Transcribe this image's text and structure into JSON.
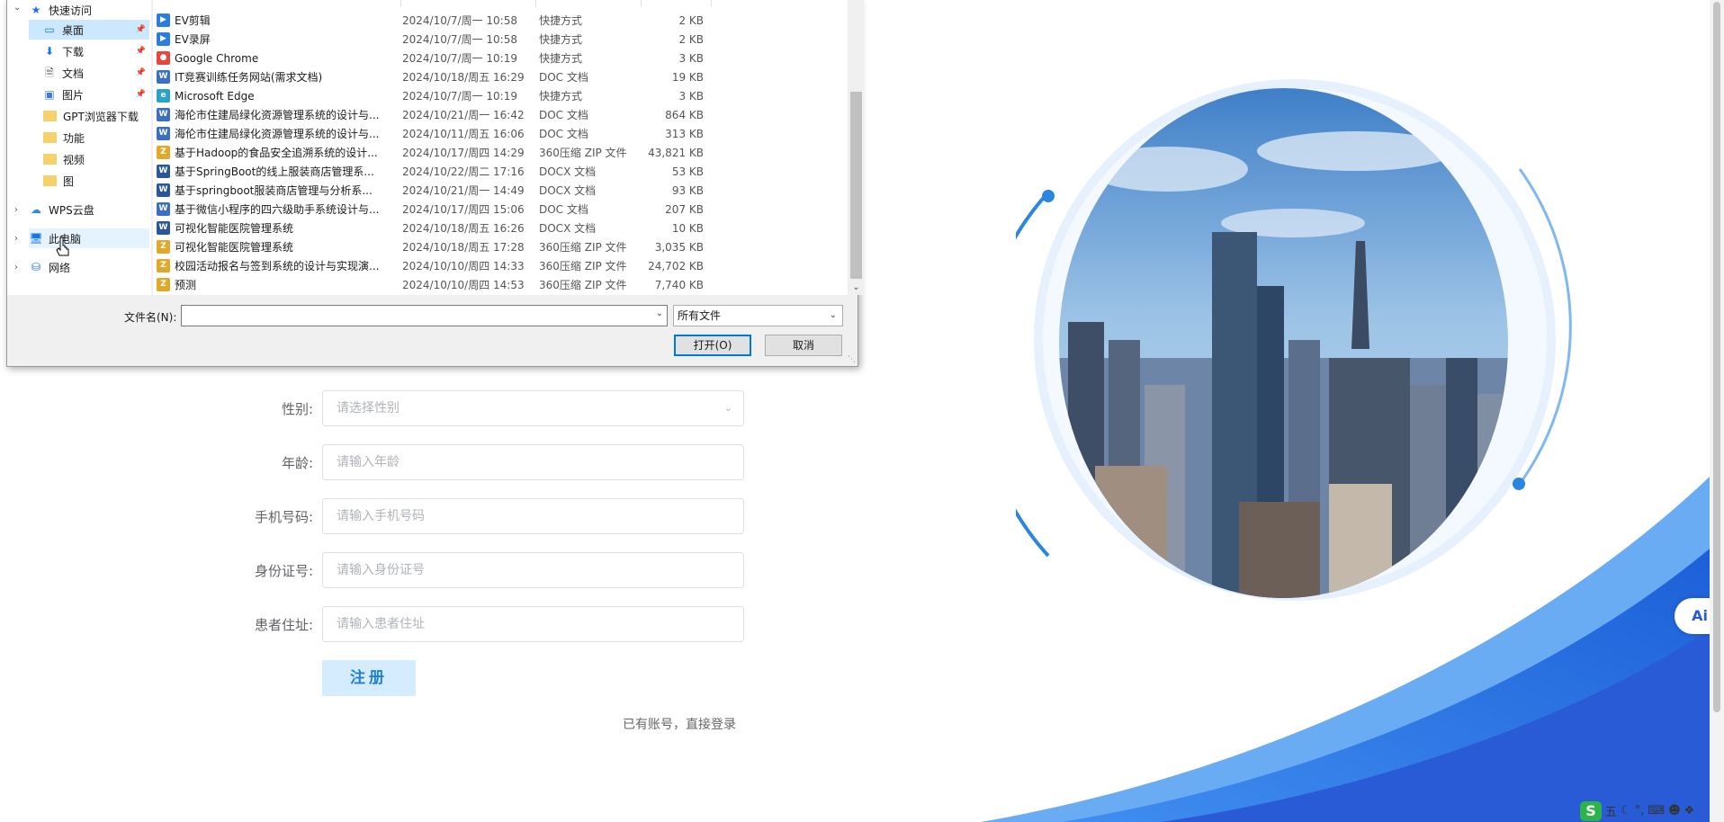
{
  "dialog": {
    "nav": {
      "quick_access": "快速访问",
      "items": [
        {
          "label": "桌面",
          "icon": "desktop-icon",
          "pinned": true
        },
        {
          "label": "下载",
          "icon": "download-icon",
          "pinned": true
        },
        {
          "label": "文档",
          "icon": "documents-icon",
          "pinned": true
        },
        {
          "label": "图片",
          "icon": "pictures-icon",
          "pinned": true
        },
        {
          "label": "GPT浏览器下载",
          "icon": "folder-icon",
          "pinned": false
        },
        {
          "label": "功能",
          "icon": "folder-icon",
          "pinned": false
        },
        {
          "label": "视频",
          "icon": "folder-icon",
          "pinned": false
        },
        {
          "label": "图",
          "icon": "folder-icon",
          "pinned": false
        }
      ],
      "wps_cloud": "WPS云盘",
      "this_pc": "此电脑",
      "network": "网络"
    },
    "files": [
      {
        "name": "EV剪辑",
        "date": "2024/10/7/周一 10:58",
        "type": "快捷方式",
        "size": "2 KB",
        "icon": "shortcut-ev-icon"
      },
      {
        "name": "EV录屏",
        "date": "2024/10/7/周一 10:58",
        "type": "快捷方式",
        "size": "2 KB",
        "icon": "shortcut-ev-icon"
      },
      {
        "name": "Google Chrome",
        "date": "2024/10/7/周一 10:19",
        "type": "快捷方式",
        "size": "3 KB",
        "icon": "chrome-icon"
      },
      {
        "name": "IT竞赛训练任务网站(需求文档)",
        "date": "2024/10/18/周五 16:29",
        "type": "DOC 文档",
        "size": "19 KB",
        "icon": "doc-icon"
      },
      {
        "name": "Microsoft Edge",
        "date": "2024/10/7/周一 10:19",
        "type": "快捷方式",
        "size": "3 KB",
        "icon": "edge-icon"
      },
      {
        "name": "海伦市住建局绿化资源管理系统的设计与...",
        "date": "2024/10/21/周一 16:42",
        "type": "DOC 文档",
        "size": "864 KB",
        "icon": "doc-icon"
      },
      {
        "name": "海伦市住建局绿化资源管理系统的设计与...",
        "date": "2024/10/11/周五 16:06",
        "type": "DOC 文档",
        "size": "313 KB",
        "icon": "doc-icon"
      },
      {
        "name": "基于Hadoop的食品安全追溯系统的设计...",
        "date": "2024/10/17/周四 14:29",
        "type": "360压缩 ZIP 文件",
        "size": "43,821 KB",
        "icon": "zip-icon"
      },
      {
        "name": "基于SpringBoot的线上服装商店管理系...",
        "date": "2024/10/22/周二 17:16",
        "type": "DOCX 文档",
        "size": "53 KB",
        "icon": "docx-icon"
      },
      {
        "name": "基于springboot服装商店管理与分析系...",
        "date": "2024/10/21/周一 14:49",
        "type": "DOCX 文档",
        "size": "93 KB",
        "icon": "docx-icon"
      },
      {
        "name": "基于微信小程序的四六级助手系统设计与...",
        "date": "2024/10/17/周四 15:06",
        "type": "DOC 文档",
        "size": "207 KB",
        "icon": "doc-icon"
      },
      {
        "name": "可视化智能医院管理系统",
        "date": "2024/10/18/周五 16:26",
        "type": "DOCX 文档",
        "size": "10 KB",
        "icon": "docx-icon"
      },
      {
        "name": "可视化智能医院管理系统",
        "date": "2024/10/18/周五 17:28",
        "type": "360压缩 ZIP 文件",
        "size": "3,035 KB",
        "icon": "zip-icon"
      },
      {
        "name": "校园活动报名与签到系统的设计与实现演...",
        "date": "2024/10/10/周四 14:33",
        "type": "360压缩 ZIP 文件",
        "size": "24,702 KB",
        "icon": "zip-icon"
      },
      {
        "name": "预测",
        "date": "2024/10/10/周四 14:53",
        "type": "360压缩 ZIP 文件",
        "size": "7,740 KB",
        "icon": "zip-icon"
      }
    ],
    "filename_label": "文件名(N):",
    "filename_value": "",
    "filetype_value": "所有文件",
    "open_button": "打开(O)",
    "cancel_button": "取消"
  },
  "form": {
    "gender_label": "性别:",
    "gender_placeholder": "请选择性别",
    "age_label": "年龄:",
    "age_placeholder": "请输入年龄",
    "phone_label": "手机号码:",
    "phone_placeholder": "请输入手机号码",
    "id_label": "身份证号:",
    "id_placeholder": "请输入身份证号",
    "address_label": "患者住址:",
    "address_placeholder": "请输入患者住址",
    "register_button": "注册",
    "login_link": "已有账号，直接登录"
  },
  "ai_badge": "Ai",
  "tray": {
    "ime_logo": "S",
    "ime_mode": "五"
  },
  "colors": {
    "brand_blue": "#1d6fe0",
    "register_bg": "#d4ecfd",
    "selection": "#cce8ff",
    "primary_border": "#0078d7"
  }
}
